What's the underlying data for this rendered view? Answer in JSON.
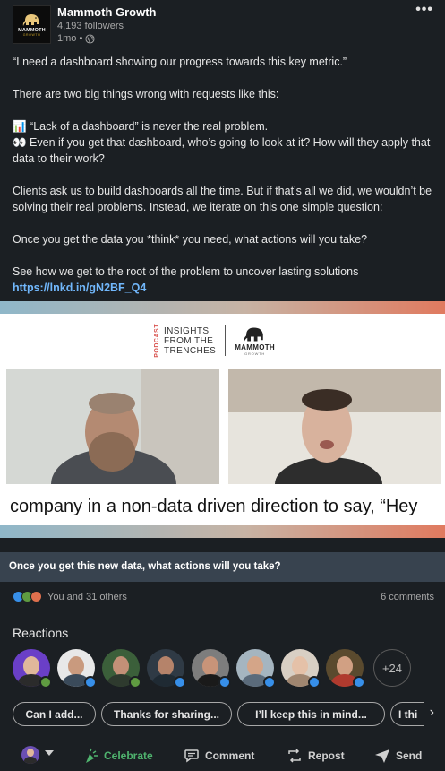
{
  "post": {
    "company_name": "Mammoth Growth",
    "logo_text": "MAMMOTH",
    "logo_subtext": "GROWTH",
    "followers": "4,193 followers",
    "time": "1mo •",
    "menu_label": "•••",
    "body": [
      "“I need a dashboard showing our progress towards this key metric.”",
      "There are two big things wrong with requests like this:",
      "📊 “Lack of a dashboard” is never the real problem.",
      "👀 Even if you get that dashboard, who’s going to look at it? How will they apply that data to their work?",
      "Clients ask us to build dashboards all the time. But if that’s all we did, we wouldn’t be solving their real problems. Instead, we iterate on this one simple question:",
      "Once you get the data you *think* you need, what actions will you take?",
      "See how we get to the root of the problem to uncover lasting solutions"
    ],
    "link": "https://lnkd.in/gN2BF_Q4"
  },
  "media": {
    "podcast_vertical": "PODCAST",
    "podcast_title_line1": "INSIGHTS",
    "podcast_title_line2": "FROM THE",
    "podcast_title_line3": "TRENCHES",
    "brand_title": "MAMMOTH",
    "brand_sub": "GROWTH",
    "caption": "company in a non-data driven direction to say, “Hey",
    "title": "Once you get this new data, what actions will you take?"
  },
  "social": {
    "reaction_count": "You and 31 others",
    "comments": "6 comments",
    "reaction_colors": [
      "#378fe9",
      "#5f9b41",
      "#df704d"
    ]
  },
  "reactions": {
    "title": "Reactions",
    "more": "+24",
    "avatar_colors": [
      "#6a3fc7",
      "#e8e8e8",
      "#3b5f3a",
      "#2f3a45",
      "#7d7d7d",
      "#a5b5c0",
      "#d8cfc4",
      "#5a4a2e"
    ],
    "badge_colors": [
      "#5f9b41",
      "#378fe9",
      "#5f9b41",
      "#378fe9",
      "#378fe9",
      "#378fe9",
      "#378fe9",
      "#378fe9"
    ]
  },
  "chips": [
    "Can I add...",
    "Thanks for sharing...",
    "I’ll keep this in mind...",
    "I thi"
  ],
  "actions": {
    "celebrate": "Celebrate",
    "comment": "Comment",
    "repost": "Repost",
    "send": "Send"
  },
  "colors": {
    "background": "#1b1f23",
    "link": "#71b7fb",
    "celebrate": "#4fb36e"
  }
}
